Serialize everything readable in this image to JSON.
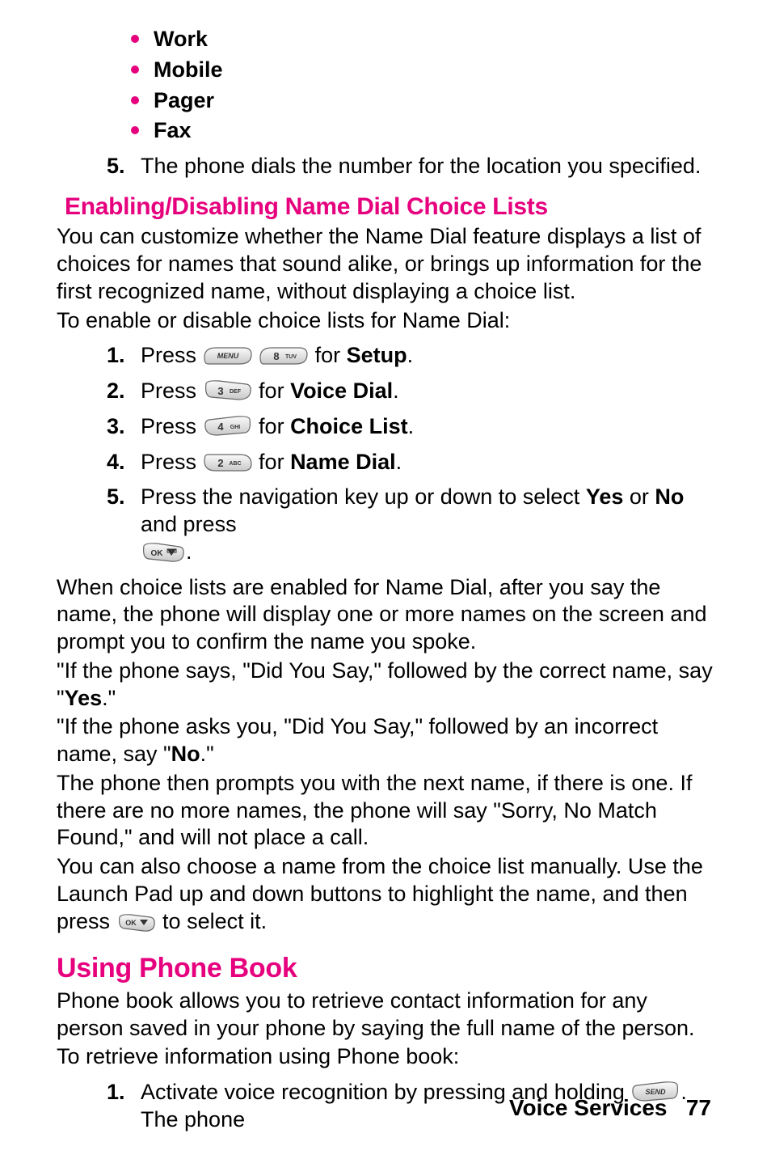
{
  "bullets": [
    "Work",
    "Mobile",
    "Pager",
    "Fax"
  ],
  "step5_top": "The phone dials the number for the location you specified.",
  "sub_heading": "Enabling/Disabling Name Dial Choice Lists",
  "para_customize": "You can customize whether the Name Dial feature displays a list of choices for names that sound alike, or brings up information for the first recognized name, without displaying a choice list.",
  "para_toenable": "To enable or disable choice lists for Name Dial:",
  "steps": {
    "s1a": "Press ",
    "s1b": " for ",
    "s1c": "Setup",
    "s2a": "Press ",
    "s2b": " for ",
    "s2c": "Voice Dial",
    "s3a": "Press ",
    "s3b": " for ",
    "s3c": "Choice List",
    "s4a": "Press ",
    "s4b": " for ",
    "s4c": "Name Dial",
    "s5a": "Press the navigation key up or down to select ",
    "s5yes": "Yes",
    "s5or": " or ",
    "s5no": "No",
    "s5b": " and press "
  },
  "period": ".",
  "para_whenchoice": "When choice lists are enabled for Name Dial, after you say the name, the phone will display one or more names on the screen and prompt you to confirm the name you spoke.",
  "para_say1a": "\"If the phone says, \"Did You Say,\" followed by the correct name, say \"",
  "yes": "Yes",
  "para_say1b": ".\"",
  "para_say2a": "\"If the phone asks you, \"Did You Say,\" followed by an incorrect name, say \"",
  "no": "No",
  "para_say2b": ".\"",
  "para_next": "The phone then prompts you with the next name, if there is one. If there are no more names, the phone will say \"Sorry, No Match Found,\" and will not place a call.",
  "para_manual_a": "You can also choose a name from the choice list manually. Use the Launch Pad up and down buttons to highlight the name, and then press ",
  "para_manual_b": " to select it.",
  "section_heading": "Using Phone Book",
  "para_pbook": "Phone book allows you to retrieve contact information for any person saved in your phone by saying the full name of the person.",
  "para_retrieve": "To retrieve information using Phone book:",
  "pb_step1a": "Activate voice recognition by pressing and holding ",
  "pb_step1b": ". The phone",
  "footer_label": "Voice Services",
  "footer_page": "77"
}
